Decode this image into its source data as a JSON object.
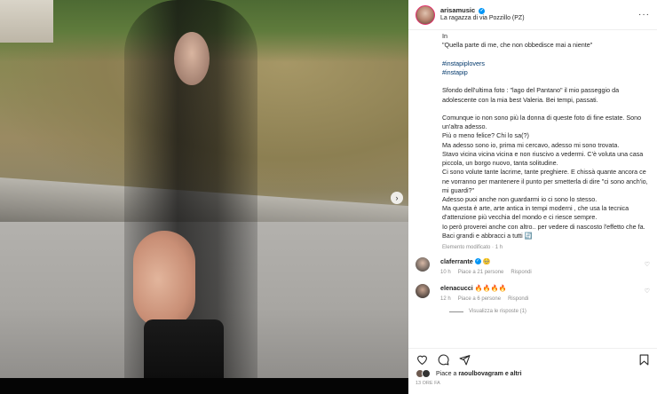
{
  "post": {
    "username": "arisamusic",
    "location": "La ragazza di via Pozzillo (PZ)",
    "caption_lines": [
      "In",
      "\"Quella parte di me, che non obbedisce mai a niente\"",
      "",
      "#instapiplovers",
      "#instapip",
      "",
      "Sfondo dell'ultima foto : \"lago del Pantano\" il mio passeggio da adolescente con la mia best Valeria. Bei tempi, passati.",
      "",
      "Comunque io non sono più la donna di queste foto di fine estate. Sono un'altra adesso.",
      "Più o meno felice? Chi lo sa(?)",
      "Ma adesso sono io, prima mi cercavo, adesso mi sono trovata.",
      "Stavo vicina vicina vicina e non riuscivo a vedermi. C'è voluta una casa piccola, un borgo nuovo, tanta solitudine.",
      "Ci sono volute tante lacrime, tante preghiere. E chissà quante ancora ce ne vorranno per mantenere il punto per smetterla di dire \"ci sono anch'io, mi guardi?\"",
      "Adesso puoi anche non guardarmi io ci sono lo stesso.",
      "Ma questa è arte, arte antica in tempi moderni , che usa la tecnica d'attenzione più vecchia del mondo e ci riesce sempre.",
      "Io però proverei anche con altro.. per vedere di nascosto l'effetto che fa.",
      "Baci grandi e abbracci a tutti 🔄"
    ],
    "edited_label": "Elemento modificato · 1 h"
  },
  "comments": [
    {
      "user": "claferrante",
      "text": "🥺",
      "time": "10 h",
      "likes": "Piace a 21 persone",
      "reply": "Rispondi"
    },
    {
      "user": "elenacucci",
      "text": "🔥🔥🔥🔥",
      "time": "12 h",
      "likes": "Piace a 6 persone",
      "reply": "Rispondi"
    }
  ],
  "view_replies": "Visualizza le risposte (1)",
  "footer": {
    "liked_by_prefix": "Piace a",
    "liked_by_user": "raoulbovagram",
    "liked_by_suffix": "e altri",
    "date": "13 ORE FA"
  },
  "icons": {
    "more": "more-horizontal-icon",
    "verified": "verified-badge-icon",
    "heart": "heart-icon",
    "comment": "comment-icon",
    "share": "share-icon",
    "save": "bookmark-icon",
    "next": "chevron-right-icon"
  },
  "colors": {
    "verified_blue": "#0095f6",
    "hashtag": "#00376b",
    "muted": "#8e8e8e"
  }
}
